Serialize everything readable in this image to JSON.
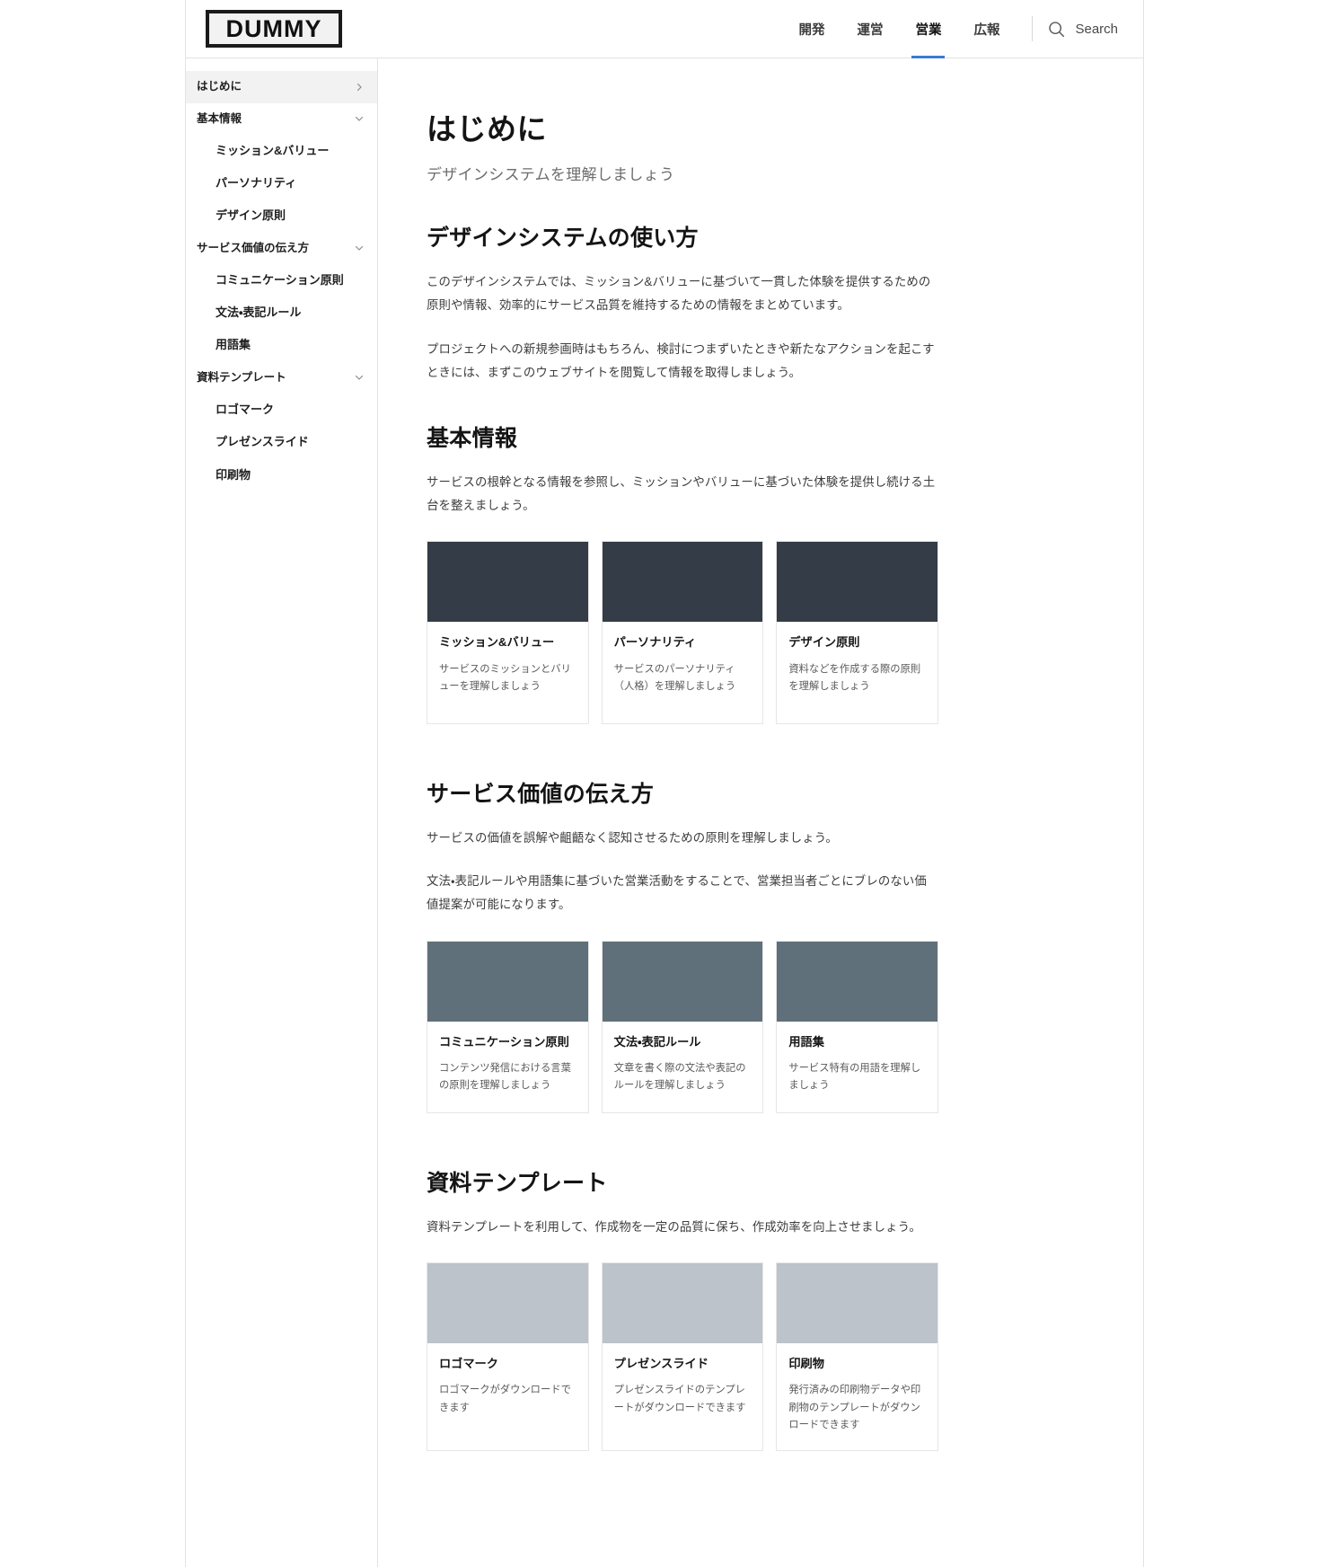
{
  "header": {
    "logo_text": "DUMMY",
    "nav": [
      {
        "label": "開発",
        "active": false
      },
      {
        "label": "運営",
        "active": false
      },
      {
        "label": "営業",
        "active": true
      },
      {
        "label": "広報",
        "active": false
      }
    ],
    "search_label": "Search",
    "search_icon": "search-icon"
  },
  "sidebar": {
    "items": [
      {
        "label": "はじめに",
        "type": "current",
        "icon": "chevron-right-icon"
      },
      {
        "label": "基本情報",
        "type": "group",
        "icon": "chevron-down-icon"
      },
      {
        "label": "ミッション&バリュー",
        "type": "child"
      },
      {
        "label": "パーソナリティ",
        "type": "child"
      },
      {
        "label": "デザイン原則",
        "type": "child"
      },
      {
        "label": "サービス価値の伝え方",
        "type": "group",
        "icon": "chevron-down-icon"
      },
      {
        "label": "コミュニケーション原則",
        "type": "child"
      },
      {
        "label": "文法・表記ルール",
        "type": "child"
      },
      {
        "label": "用語集",
        "type": "child"
      },
      {
        "label": "資料テンプレート",
        "type": "group",
        "icon": "chevron-down-icon"
      },
      {
        "label": "ロゴマーク",
        "type": "child"
      },
      {
        "label": "プレゼンスライド",
        "type": "child"
      },
      {
        "label": "印刷物",
        "type": "child"
      }
    ]
  },
  "main": {
    "title": "はじめに",
    "subtitle": "デザインシステムを理解しましょう",
    "sections": [
      {
        "heading": "デザインシステムの使い方",
        "paragraphs": [
          "このデザインシステムでは、ミッション&バリューに基づいて一貫した体験を提供するための原則や情報、効率的にサービス品質を維持するための情報をまとめています。",
          "プロジェクトへの新規参画時はもちろん、検討につまずいたときや新たなアクションを起こすときには、まずこのウェブサイトを閲覧して情報を取得しましょう。"
        ],
        "cards": []
      },
      {
        "heading": "基本情報",
        "paragraphs": [
          "サービスの根幹となる情報を参照し、ミッションやバリューに基づいた体験を提供し続ける土台を整えましょう。"
        ],
        "thumb_color": "#333c47",
        "cards": [
          {
            "title": "ミッション&バリュー",
            "desc": "サービスのミッションとバリューを理解しましょう"
          },
          {
            "title": "パーソナリティ",
            "desc": "サービスのパーソナリティ（人格）を理解しましょう"
          },
          {
            "title": "デザイン原則",
            "desc": "資料などを作成する際の原則を理解しましょう"
          }
        ]
      },
      {
        "heading": "サービス価値の伝え方",
        "paragraphs": [
          "サービスの価値を誤解や齟齬なく認知させるための原則を理解しましょう。",
          "文法・表記ルールや用語集に基づいた営業活動をすることで、営業担当者ごとにブレのない価値提案が可能になります。"
        ],
        "thumb_color": "#60707a",
        "cards": [
          {
            "title": "コミュニケーション原則",
            "desc": "コンテンツ発信における言葉の原則を理解しましょう"
          },
          {
            "title": "文法・表記ルール",
            "desc": "文章を書く際の文法や表記のルールを理解しましょう"
          },
          {
            "title": "用語集",
            "desc": "サービス特有の用語を理解しましょう"
          }
        ]
      },
      {
        "heading": "資料テンプレート",
        "paragraphs": [
          "資料テンプレートを利用して、作成物を一定の品質に保ち、作成効率を向上させましょう。"
        ],
        "thumb_color": "#bcc3ca",
        "cards": [
          {
            "title": "ロゴマーク",
            "desc": "ロゴマークがダウンロードできます"
          },
          {
            "title": "プレゼンスライド",
            "desc": "プレゼンスライドのテンプレートがダウンロードできます"
          },
          {
            "title": "印刷物",
            "desc": "発行済みの印刷物データや印刷物のテンプレートがダウンロードできます"
          }
        ]
      }
    ]
  },
  "colors": {
    "accent": "#3a7bd5",
    "thumb_dark": "#333c47",
    "thumb_mid": "#60707a",
    "thumb_light": "#bcc3ca",
    "border": "#e3e3e3",
    "text": "#141414"
  }
}
